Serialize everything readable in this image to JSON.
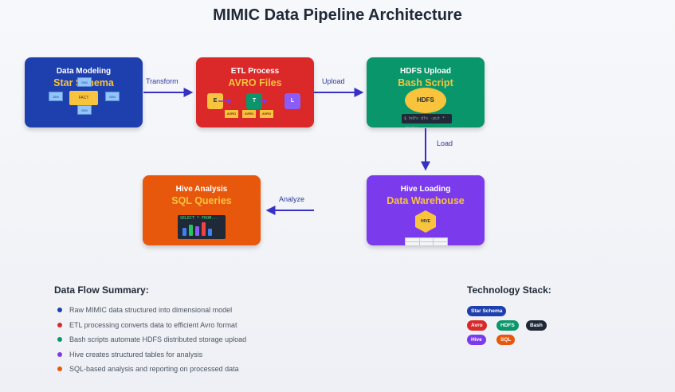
{
  "title": "MIMIC Data Pipeline Architecture",
  "stages": [
    {
      "title": "Data Modeling",
      "subtitle": "Star Schema",
      "color": "#1e3fae",
      "icon": {
        "dims": [
          "DIM",
          "DIM",
          "DIM",
          "DIM"
        ],
        "fact": "FACT"
      }
    },
    {
      "title": "ETL Process",
      "subtitle": "AVRO Files",
      "color": "#db2929",
      "icon": {
        "steps": [
          "E",
          "T",
          "L"
        ],
        "files": [
          "AVRO",
          "AVRO",
          "AVRO"
        ]
      }
    },
    {
      "title": "HDFS Upload",
      "subtitle": "Bash Script",
      "color": "#08966a",
      "icon": {
        "label": "HDFS",
        "command": "$ hdfs dfs -put * /mimic"
      }
    },
    {
      "title": "Hive Loading",
      "subtitle": "Data Warehouse",
      "color": "#7c3aed",
      "icon": {
        "label": "HIVE"
      }
    },
    {
      "title": "Hive Analysis",
      "subtitle": "SQL Queries",
      "color": "#e8580c",
      "icon": {
        "query": "SELECT * FROM..."
      }
    }
  ],
  "arrows": {
    "transform": "Transform",
    "upload": "Upload",
    "load": "Load",
    "analyze": "Analyze"
  },
  "summary": {
    "title": "Data Flow Summary:",
    "items": [
      {
        "text": "Raw MIMIC data structured into dimensional model",
        "color": "#1e3fae"
      },
      {
        "text": "ETL processing converts data to efficient Avro format",
        "color": "#db2929"
      },
      {
        "text": "Bash scripts automate HDFS distributed storage upload",
        "color": "#08966a"
      },
      {
        "text": "Hive creates structured tables for analysis",
        "color": "#7c3aed"
      },
      {
        "text": "SQL-based analysis and reporting on processed data",
        "color": "#e8580c"
      }
    ]
  },
  "tech": {
    "title": "Technology Stack:",
    "pills": [
      {
        "label": "Star Schema",
        "color": "#1e3fae"
      },
      {
        "label": "Avro",
        "color": "#db2929"
      },
      {
        "label": "HDFS",
        "color": "#08966a"
      },
      {
        "label": "Bash",
        "color": "#1f2937"
      },
      {
        "label": "Hive",
        "color": "#7c3aed"
      },
      {
        "label": "SQL",
        "color": "#e8580c"
      }
    ]
  }
}
